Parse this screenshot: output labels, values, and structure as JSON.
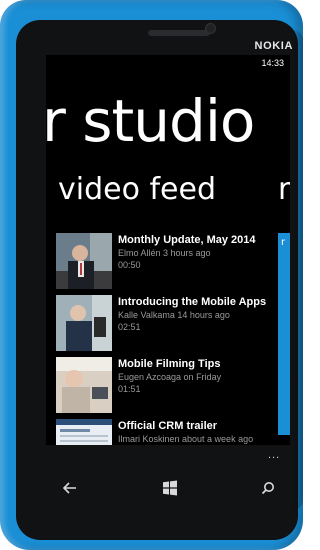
{
  "status": {
    "time": "14:33"
  },
  "device": {
    "brand": "NOKIA"
  },
  "app": {
    "panorama_title": "r studio",
    "section_title": "video feed",
    "next_section_title": "r"
  },
  "videos": [
    {
      "title": "Monthly Update, May 2014",
      "meta": "Elmo Allén 3 hours ago",
      "duration": "00:50"
    },
    {
      "title": "Introducing the Mobile Apps",
      "meta": "Kalle Valkama 14 hours ago",
      "duration": "02:51"
    },
    {
      "title": "Mobile Filming Tips",
      "meta": "Eugen Azcoaga on Friday",
      "duration": "01:51"
    },
    {
      "title": "Official CRM trailer",
      "meta": "Ilmari Koskinen about a week ago",
      "duration": ""
    }
  ],
  "appbar": {
    "more": "..."
  },
  "icons": {
    "back": "back-arrow-icon",
    "start": "windows-logo-icon",
    "search": "search-icon"
  },
  "colors": {
    "accent": "#1a8fd6",
    "screen_bg": "#000000"
  }
}
